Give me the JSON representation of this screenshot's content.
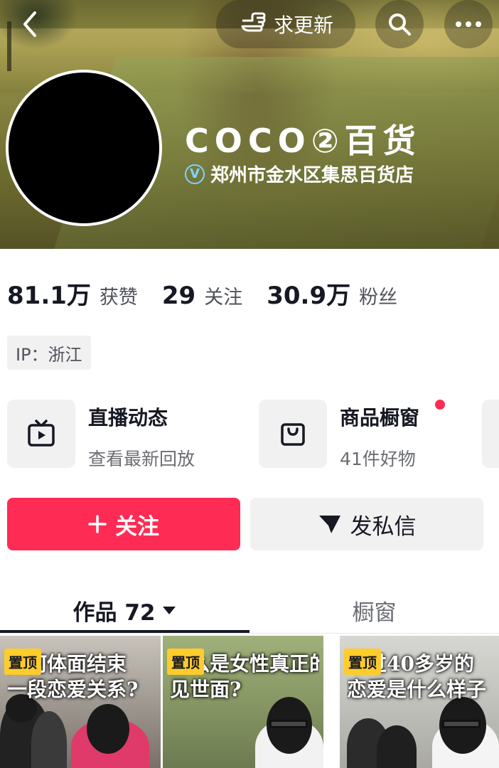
{
  "header": {
    "update_request_label": "求更新",
    "nickname": "COCO②百货",
    "verification_text": "郑州市金水区集思百货店",
    "verify_badge_letter": "V"
  },
  "stats": [
    {
      "value": "81.1万",
      "label": "获赞"
    },
    {
      "value": "29",
      "label": "关注"
    },
    {
      "value": "30.9万",
      "label": "粉丝"
    }
  ],
  "ip_location": "IP：浙江",
  "features": [
    {
      "title": "直播动态",
      "subtitle": "查看最新回放",
      "icon": "tv-icon"
    },
    {
      "title": "商品橱窗",
      "subtitle": "41件好物",
      "icon": "shopping-bag-icon",
      "has_notification_dot": true
    }
  ],
  "actions": {
    "follow_label": "关注",
    "message_label": "发私信"
  },
  "tabs": [
    {
      "label": "作品 72",
      "active": true
    },
    {
      "label": "橱窗",
      "active": false
    }
  ],
  "videos": [
    {
      "pinned_label": "置顶",
      "caption_lines": [
        "如何体面结束",
        "一段恋爱关系?"
      ]
    },
    {
      "pinned_label": "置顶",
      "caption_lines": [
        "什么是女性真正的",
        "见世面?"
      ]
    },
    {
      "pinned_label": "置顶",
      "caption_lines": [
        "年过40多岁的",
        "恋爱是什么样子"
      ]
    }
  ],
  "colors": {
    "brand_red": "#fe2c55",
    "pin_yellow": "#fecc2b",
    "text_primary": "#161823",
    "verify_blue": "#7fd3ff"
  }
}
